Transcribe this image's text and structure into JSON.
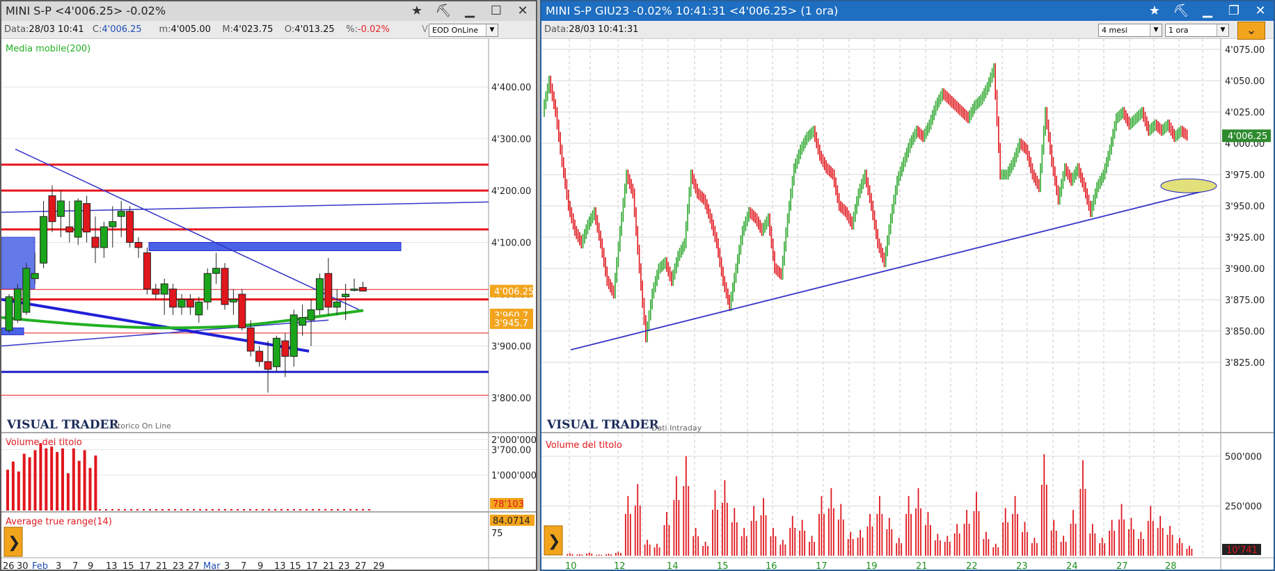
{
  "left": {
    "title": "MINI S-P <4'006.25> -0.02%",
    "info": {
      "data_label": "Data:",
      "data_value": "28/03 10:41",
      "close_label": "C:",
      "close_value": "4'006.25",
      "min_label": "m:",
      "min_value": "4'005.00",
      "max_label": "M:",
      "max_value": "4'023.75",
      "open_label": "O:",
      "open_value": "4'013.25",
      "pct_label": "%:",
      "pct_value": "-0.02%",
      "source_letter": "V",
      "source_select": "EOD OnLine"
    },
    "indicator_label": "Media mobile(200)",
    "price_axis": [
      "4'400.00",
      "4'300.00",
      "4'200.00",
      "4'100.00",
      "4'000.00",
      "3'900.00",
      "3'800.00",
      "3'700.00"
    ],
    "badges": {
      "last": "4'006.25",
      "ma1": "3'960.7",
      "ma2": "3'945.7"
    },
    "logo": "VISUAL TRADER",
    "logo_sub": "Storico On Line",
    "volume_label": "Volume del titolo",
    "volume_axis": [
      "2'000'000",
      "1'000'000"
    ],
    "volume_badge": "78'103",
    "atr_label": "Average true range(14)",
    "atr_badge": "84.0714",
    "atr_axis": "75",
    "date_axis": [
      "26",
      "30",
      "Feb",
      "3",
      "7",
      "9",
      "13",
      "15",
      "17",
      "21",
      "23",
      "27",
      "Mar",
      "3",
      "7",
      "9",
      "13",
      "15",
      "17",
      "21",
      "23",
      "27",
      "29"
    ],
    "colors": {
      "up": "#1aa51a",
      "down": "#e0171d",
      "level_line": "#e8141c",
      "trend_line": "#3434c8",
      "ma_line": "#22b022",
      "zone": "#4a63e6",
      "badge": "#f2a41c"
    },
    "candles": [
      {
        "o": 3930,
        "h": 4000,
        "l": 3925,
        "c": 3995
      },
      {
        "o": 3950,
        "h": 4020,
        "l": 3945,
        "c": 4010
      },
      {
        "o": 3965,
        "h": 4060,
        "l": 3960,
        "c": 4050
      },
      {
        "o": 4030,
        "h": 4080,
        "l": 4020,
        "c": 4040
      },
      {
        "o": 4060,
        "h": 4180,
        "l": 4050,
        "c": 4150
      },
      {
        "o": 4190,
        "h": 4210,
        "l": 4120,
        "c": 4140
      },
      {
        "o": 4150,
        "h": 4200,
        "l": 4110,
        "c": 4180
      },
      {
        "o": 4130,
        "h": 4180,
        "l": 4100,
        "c": 4120
      },
      {
        "o": 4110,
        "h": 4185,
        "l": 4095,
        "c": 4180
      },
      {
        "o": 4175,
        "h": 4190,
        "l": 4100,
        "c": 4120
      },
      {
        "o": 4110,
        "h": 4150,
        "l": 4060,
        "c": 4090
      },
      {
        "o": 4090,
        "h": 4140,
        "l": 4070,
        "c": 4130
      },
      {
        "o": 4130,
        "h": 4170,
        "l": 4090,
        "c": 4140
      },
      {
        "o": 4150,
        "h": 4180,
        "l": 4110,
        "c": 4160
      },
      {
        "o": 4160,
        "h": 4170,
        "l": 4090,
        "c": 4100
      },
      {
        "o": 4100,
        "h": 4110,
        "l": 4070,
        "c": 4090
      },
      {
        "o": 4080,
        "h": 4090,
        "l": 4000,
        "c": 4010
      },
      {
        "o": 4010,
        "h": 4020,
        "l": 3990,
        "c": 4000
      },
      {
        "o": 4000,
        "h": 4030,
        "l": 3960,
        "c": 4020
      },
      {
        "o": 4010,
        "h": 4020,
        "l": 3960,
        "c": 3975
      },
      {
        "o": 3975,
        "h": 4000,
        "l": 3960,
        "c": 3990
      },
      {
        "o": 3990,
        "h": 4000,
        "l": 3960,
        "c": 3975
      },
      {
        "o": 3960,
        "h": 3995,
        "l": 3945,
        "c": 3985
      },
      {
        "o": 3985,
        "h": 4050,
        "l": 3970,
        "c": 4040
      },
      {
        "o": 4040,
        "h": 4080,
        "l": 4020,
        "c": 4050
      },
      {
        "o": 4050,
        "h": 4060,
        "l": 3970,
        "c": 3980
      },
      {
        "o": 3985,
        "h": 4010,
        "l": 3960,
        "c": 3990
      },
      {
        "o": 4000,
        "h": 4010,
        "l": 3930,
        "c": 3935
      },
      {
        "o": 3935,
        "h": 3950,
        "l": 3880,
        "c": 3890
      },
      {
        "o": 3890,
        "h": 3900,
        "l": 3860,
        "c": 3870
      },
      {
        "o": 3870,
        "h": 3910,
        "l": 3810,
        "c": 3855
      },
      {
        "o": 3860,
        "h": 3920,
        "l": 3850,
        "c": 3915
      },
      {
        "o": 3910,
        "h": 3925,
        "l": 3840,
        "c": 3880
      },
      {
        "o": 3880,
        "h": 3970,
        "l": 3860,
        "c": 3960
      },
      {
        "o": 3940,
        "h": 3980,
        "l": 3920,
        "c": 3955
      },
      {
        "o": 3950,
        "h": 3990,
        "l": 3900,
        "c": 3970
      },
      {
        "o": 3970,
        "h": 4040,
        "l": 3960,
        "c": 4030
      },
      {
        "o": 4040,
        "h": 4070,
        "l": 3960,
        "c": 3975
      },
      {
        "o": 3975,
        "h": 4010,
        "l": 3960,
        "c": 3985
      },
      {
        "o": 3995,
        "h": 4020,
        "l": 3950,
        "c": 4000
      },
      {
        "o": 4010,
        "h": 4030,
        "l": 4005,
        "c": 4010
      },
      {
        "o": 4013,
        "h": 4024,
        "l": 4005,
        "c": 4006
      }
    ],
    "volumes": [
      1150000,
      1380000,
      1100000,
      1600000,
      1500000,
      1700000,
      1900000,
      1750000,
      1800000,
      1650000,
      1750000,
      1050000,
      1750000,
      1400000,
      1700000,
      1200000,
      1550000
    ]
  },
  "right": {
    "title": "MINI S-P GIU23 -0.02% 10:41:31 <4'006.25> (1 ora)",
    "info": {
      "data_label": "Data:",
      "data_value": "28/03 10:41:31"
    },
    "period_select": "4 mesi",
    "interval_select": "1 ora",
    "price_axis": [
      "4'075.00",
      "4'050.00",
      "4'025.00",
      "4'000.00",
      "3'975.00",
      "3'950.00",
      "3'925.00",
      "3'900.00",
      "3'875.00",
      "3'850.00",
      "3'825.00"
    ],
    "last_badge": "4'006.25",
    "logo": "VISUAL TRADER",
    "logo_sub": "Dati Intraday",
    "volume_label": "Volume del titolo",
    "volume_axis": [
      "500'000",
      "250'000"
    ],
    "volume_badge": "10'741",
    "date_axis": [
      "10",
      "12",
      "14",
      "15",
      "16",
      "17",
      "19",
      "21",
      "22",
      "23",
      "24",
      "27",
      "28"
    ],
    "colors": {
      "up": "#2fa82f",
      "down": "#e0171d",
      "trend_line": "#3434c8",
      "ellipse": "#e2e07a",
      "badge": "#2e8a2e"
    },
    "price_path": [
      4025,
      4050,
      4025,
      3985,
      3950,
      3930,
      3920,
      3935,
      3945,
      3920,
      3890,
      3880,
      3930,
      3975,
      3960,
      3900,
      3845,
      3880,
      3900,
      3905,
      3890,
      3910,
      3920,
      3975,
      3960,
      3955,
      3940,
      3920,
      3890,
      3870,
      3900,
      3930,
      3945,
      3940,
      3930,
      3940,
      3900,
      3895,
      3940,
      3980,
      3995,
      4005,
      4010,
      3990,
      3980,
      3975,
      3950,
      3945,
      3935,
      3960,
      3975,
      3950,
      3920,
      3905,
      3940,
      3970,
      3985,
      4000,
      4010,
      4005,
      4015,
      4030,
      4040,
      4035,
      4030,
      4025,
      4020,
      4030,
      4035,
      4045,
      4060,
      3975,
      3975,
      3985,
      4000,
      3995,
      3975,
      3965,
      4025,
      3985,
      3955,
      3980,
      3970,
      3980,
      3965,
      3945,
      3965,
      3975,
      3995,
      4020,
      4025,
      4015,
      4020,
      4025,
      4010,
      4015,
      4010,
      4015,
      4005,
      4010,
      4006
    ],
    "volumes": [
      12000,
      8000,
      15000,
      6000,
      10000,
      20000,
      300000,
      360000,
      80000,
      60000,
      220000,
      400000,
      500000,
      140000,
      70000,
      330000,
      380000,
      240000,
      140000,
      250000,
      290000,
      140000,
      80000,
      200000,
      180000,
      100000,
      300000,
      340000,
      260000,
      120000,
      130000,
      210000,
      300000,
      190000,
      90000,
      300000,
      340000,
      220000,
      110000,
      100000,
      160000,
      230000,
      320000,
      120000,
      60000,
      240000,
      300000,
      170000,
      90000,
      510000,
      180000,
      100000,
      230000,
      480000,
      160000,
      90000,
      180000,
      260000,
      190000,
      120000,
      250000,
      200000,
      150000,
      90000,
      50000
    ]
  }
}
